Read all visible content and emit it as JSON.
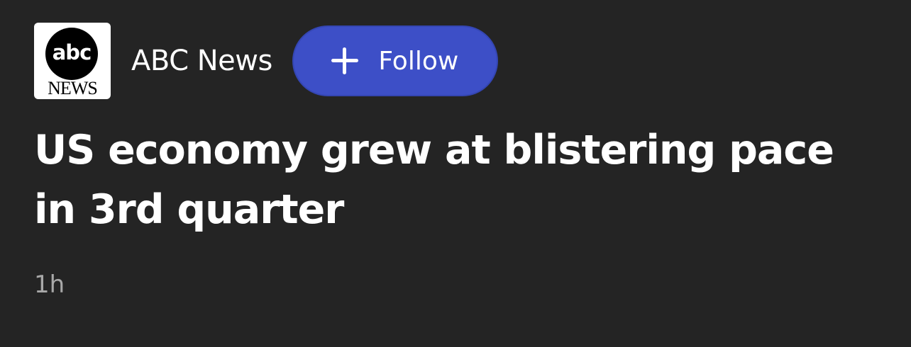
{
  "source": {
    "logo": {
      "icon": "abc-news-logo",
      "text_top": "abc",
      "text_bottom": "NEWS"
    },
    "name": "ABC News",
    "follow_button": {
      "icon": "plus-icon",
      "label": "Follow",
      "color": "#3d4fc7"
    }
  },
  "article": {
    "headline": "US economy grew at blistering pace in 3rd quarter",
    "timestamp": "1h"
  },
  "colors": {
    "background": "#242424",
    "text": "#ffffff",
    "muted_text": "#a8a8a8"
  }
}
